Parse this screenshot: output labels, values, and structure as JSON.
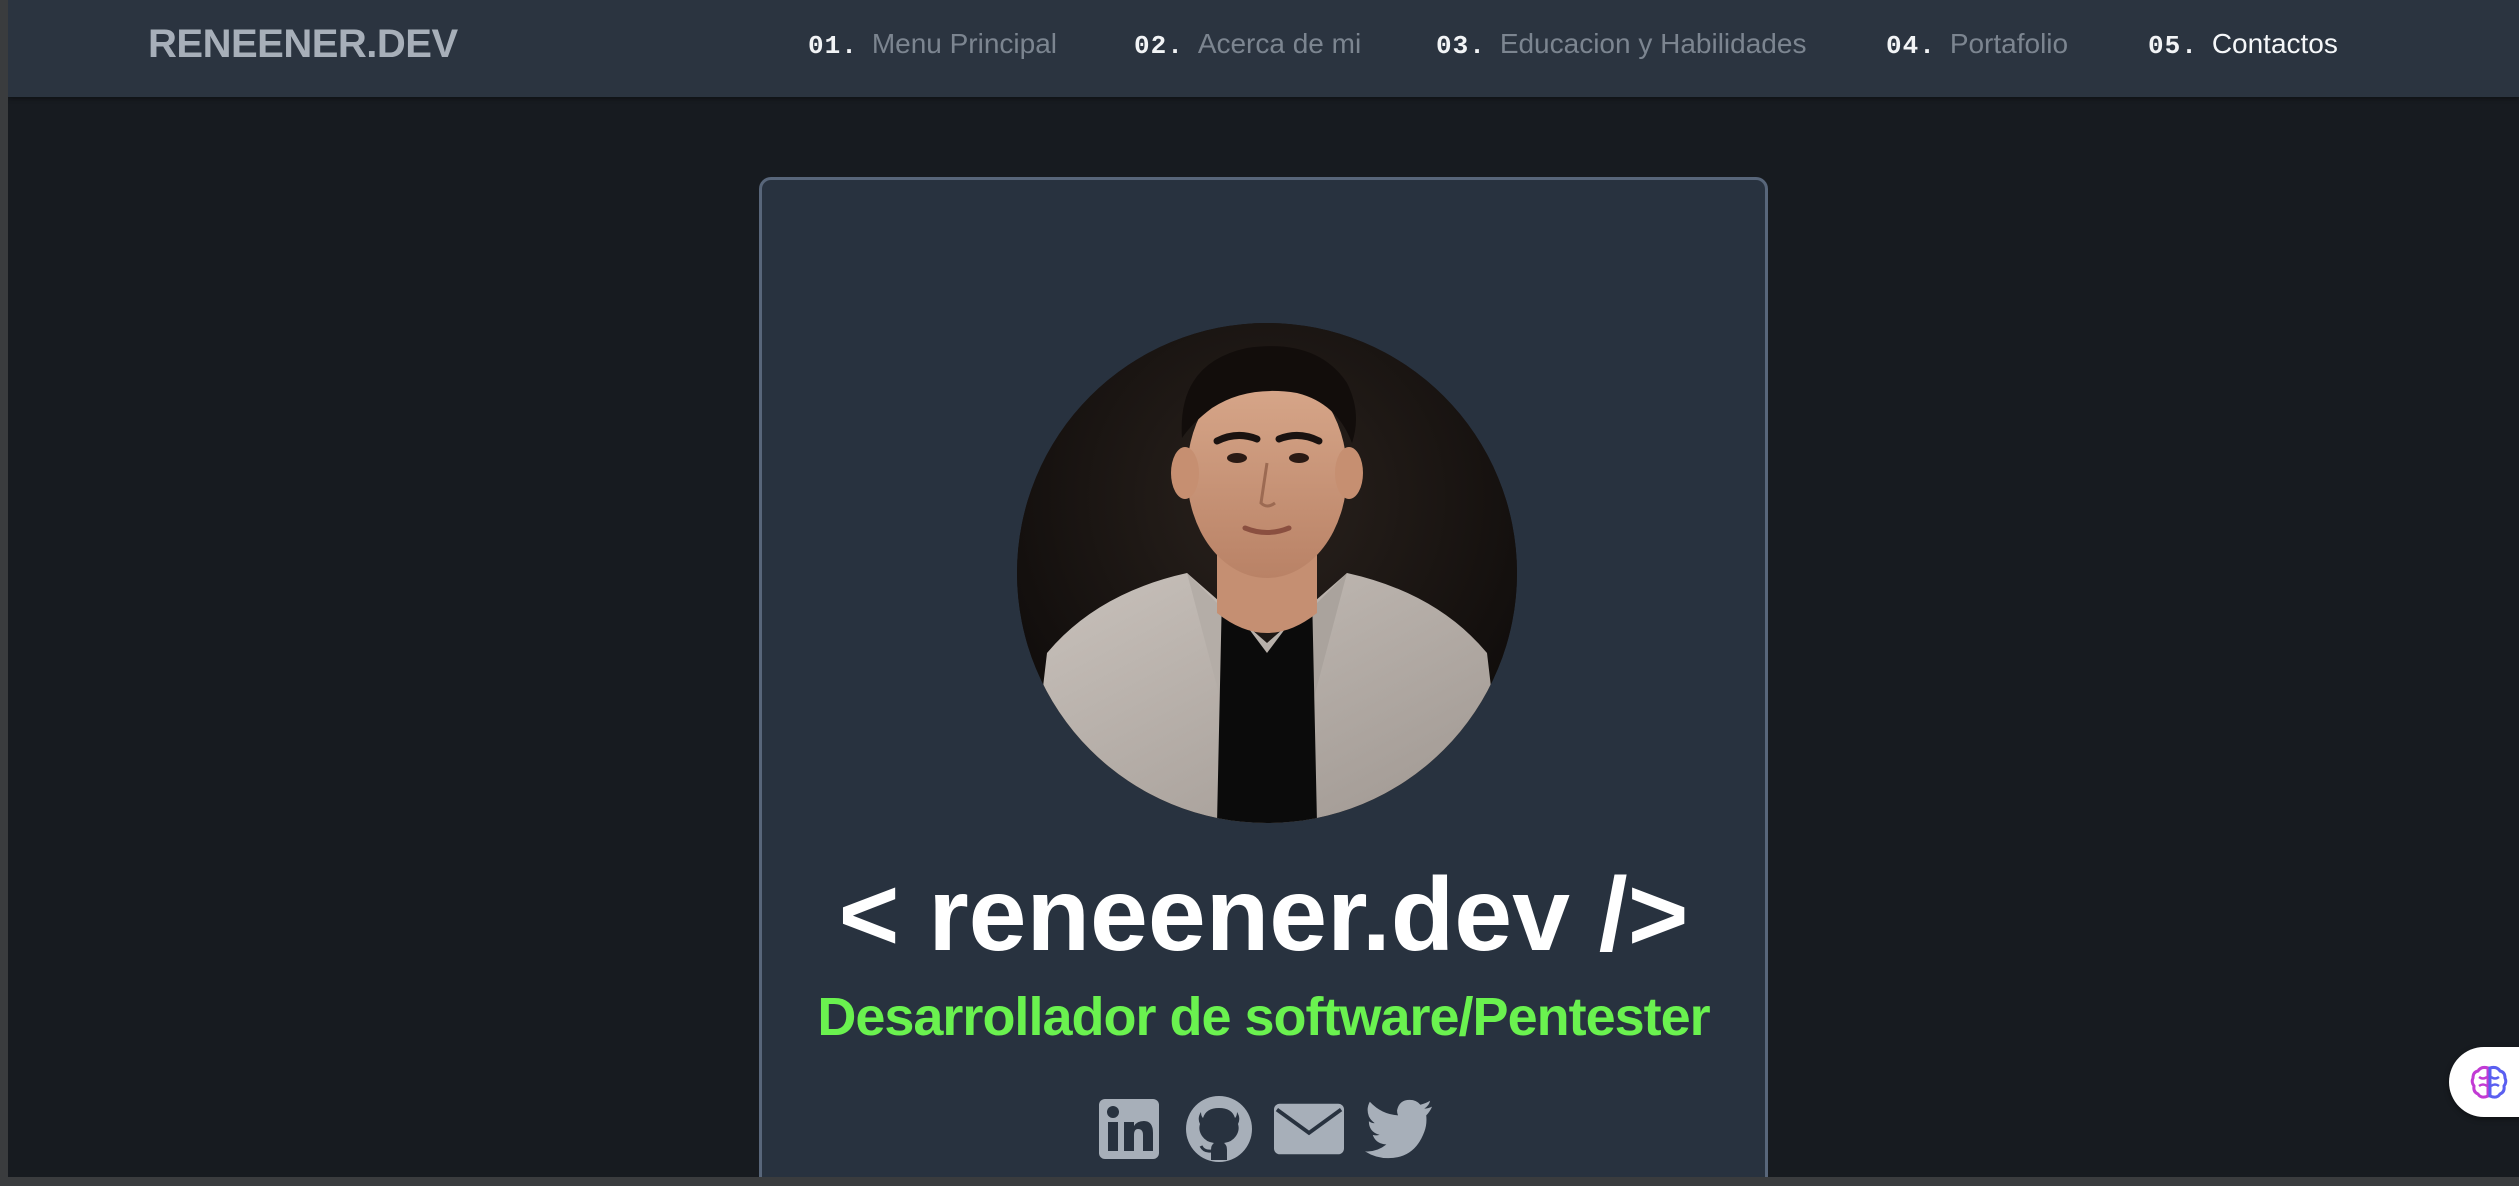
{
  "navbar": {
    "brand": "RENEENER.DEV",
    "items": [
      {
        "num": "01.",
        "label": "Menu Principal",
        "active": false
      },
      {
        "num": "02.",
        "label": "Acerca de mi",
        "active": false
      },
      {
        "num": "03.",
        "label": "Educacion y Habilidades",
        "active": false
      },
      {
        "num": "04.",
        "label": "Portafolio",
        "active": false
      },
      {
        "num": "05.",
        "label": "Contactos",
        "active": true
      }
    ]
  },
  "card": {
    "title": "< reneener.dev />",
    "subtitle": "Desarrollador de software/Pentester",
    "socials": [
      {
        "name": "linkedin",
        "icon": "linkedin-icon"
      },
      {
        "name": "github",
        "icon": "github-icon"
      },
      {
        "name": "email",
        "icon": "envelope-icon"
      },
      {
        "name": "twitter",
        "icon": "twitter-icon"
      }
    ]
  },
  "colors": {
    "page_bg": "#171b20",
    "navbar_bg": "#2b3440",
    "card_bg": "#28323f",
    "card_border": "#58667a",
    "accent_green": "#6af24f",
    "muted_text": "#7c8590",
    "icon_gray": "#a7afb9"
  },
  "widget": {
    "icon": "brain-icon"
  }
}
